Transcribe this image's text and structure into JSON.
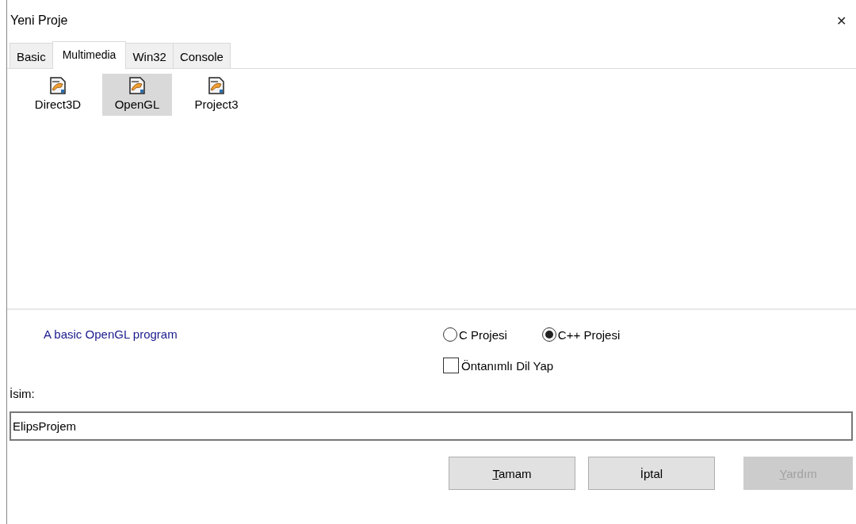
{
  "window": {
    "title": "Yeni Proje",
    "close": "✕"
  },
  "tabs": [
    {
      "label": "Basic",
      "selected": false
    },
    {
      "label": "Multimedia",
      "selected": true
    },
    {
      "label": "Win32",
      "selected": false
    },
    {
      "label": "Console",
      "selected": false
    }
  ],
  "templates": [
    {
      "label": "Direct3D",
      "selected": false
    },
    {
      "label": "OpenGL",
      "selected": true
    },
    {
      "label": "Project3",
      "selected": false
    }
  ],
  "description": "A basic OpenGL program",
  "language": [
    {
      "label": "C Projesi",
      "selected": false
    },
    {
      "label": "C++ Projesi",
      "selected": true
    }
  ],
  "default_language": {
    "label": "Öntanımlı Dil Yap",
    "checked": false
  },
  "name_field": {
    "label": "İsim:",
    "value": "ElipsProjem"
  },
  "buttons": [
    {
      "label": "Tamam",
      "underline_first": true,
      "disabled": false
    },
    {
      "label": "İptal",
      "underline_first": false,
      "disabled": false
    },
    {
      "label": "Yardım",
      "underline_first": true,
      "disabled": true
    }
  ]
}
